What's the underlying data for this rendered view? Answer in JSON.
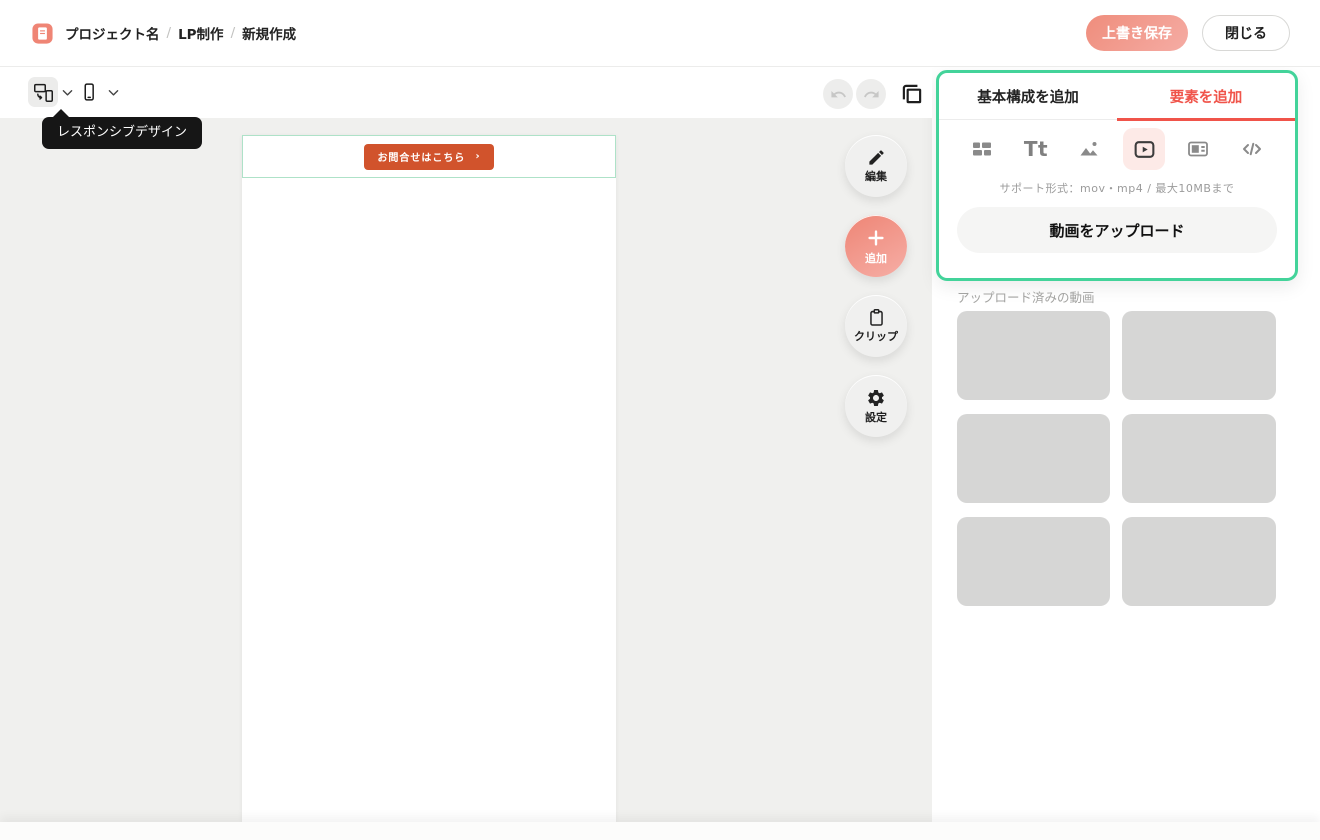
{
  "header": {
    "breadcrumb": {
      "items": [
        "プロジェクト名",
        "LP制作",
        "新規作成"
      ],
      "separator": "/"
    },
    "save_button": "上書き保存",
    "close_button": "閉じる"
  },
  "toolbar": {
    "tooltip": "レスポンシブデザイン",
    "icons": [
      "responsive-design-icon",
      "mobile-preview-icon",
      "undo-icon",
      "redo-icon",
      "duplicate-icon"
    ]
  },
  "canvas": {
    "cta_label": "お問合せはこちら",
    "cta_arrow": "›"
  },
  "floating": {
    "edit_label": "編集",
    "add_label": "追加",
    "clip_label": "クリップ",
    "settings_label": "設定"
  },
  "panel": {
    "tab_basic": "基本構成を追加",
    "tab_elements": "要素を追加",
    "element_icons": [
      "section-layout-icon",
      "text-icon",
      "image-icon",
      "video-icon",
      "embed-icon",
      "code-icon"
    ],
    "selected_element": "video-icon",
    "text_icon_glyph": "Tt",
    "support_text": "サポート形式：mov・mp4 / 最大10MBまで",
    "upload_button": "動画をアップロード",
    "uploaded_label": "アップロード済みの動画",
    "thumbnail_count": 6
  },
  "colors": {
    "accent_red": "#f0544a",
    "mint_green": "#43d39a",
    "band_border": "#aee2c8",
    "cta_orange": "#d1532c",
    "coral_gradient_from": "#ee8575",
    "coral_gradient_to": "#f6aea6",
    "workspace_bg": "#f0f0ee",
    "thumb_gray": "#d6d6d5",
    "tooltip_bg": "#161616"
  }
}
